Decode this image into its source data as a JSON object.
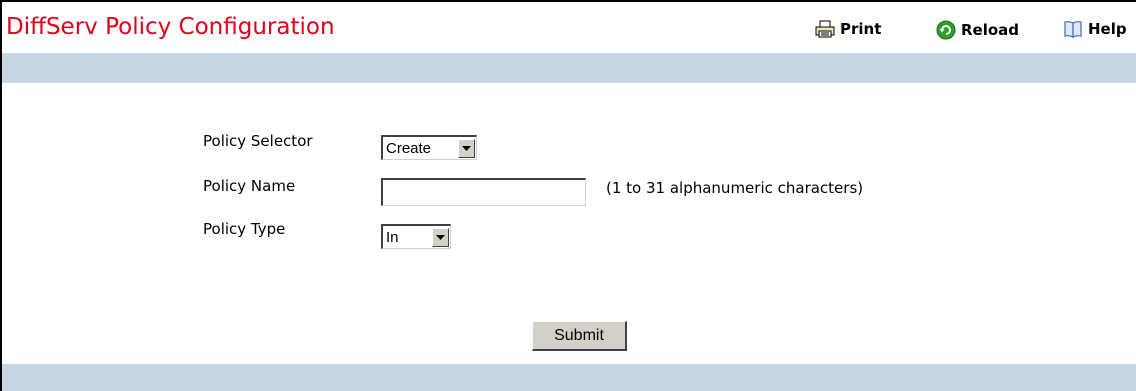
{
  "header": {
    "title": "DiffServ Policy Configuration",
    "print_label": "Print",
    "reload_label": "Reload",
    "help_label": "Help"
  },
  "form": {
    "policy_selector": {
      "label": "Policy Selector",
      "value": "Create"
    },
    "policy_name": {
      "label": "Policy Name",
      "value": "",
      "hint": "(1 to 31 alphanumeric characters)"
    },
    "policy_type": {
      "label": "Policy Type",
      "value": "In"
    },
    "submit_label": "Submit"
  },
  "colors": {
    "title": "#e0001a",
    "bar": "#c6d7e3",
    "reload_icon": "#2e9e2e",
    "help_icon": "#3a6fb0"
  },
  "icons": {
    "print": "printer-icon",
    "reload": "reload-icon",
    "help": "book-icon"
  }
}
